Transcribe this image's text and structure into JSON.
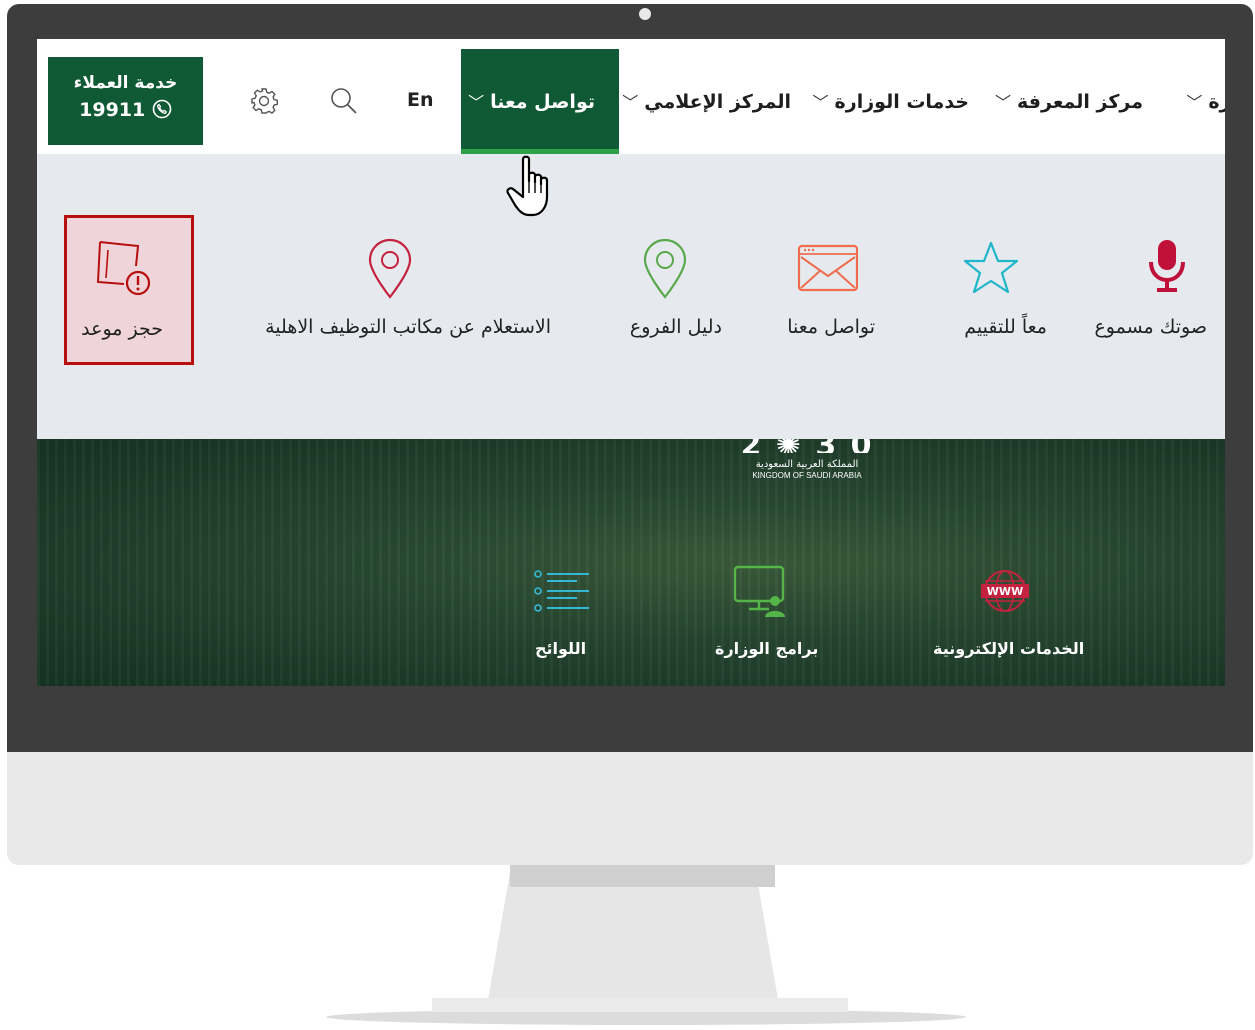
{
  "customer_service": {
    "title": "خدمة العملاء",
    "phone": "19911"
  },
  "toolbar": {
    "language_label": "En",
    "settings_icon": "gear-icon",
    "search_icon": "search-icon"
  },
  "nav": {
    "active": "تواصل معنا",
    "items": [
      "المركز الإعلامي",
      "خدمات الوزارة",
      "مركز المعرفة",
      "ارة"
    ]
  },
  "mega_menu": {
    "items": [
      {
        "label": "صوتك مسموع",
        "icon": "microphone-icon",
        "color": "#c0113a"
      },
      {
        "label": "معاً للتقييم",
        "icon": "star-icon",
        "color": "#1fb6c9"
      },
      {
        "label": "تواصل معنا",
        "icon": "envelope-icon",
        "color": "#ef6d4e"
      },
      {
        "label": "دليل الفروع",
        "icon": "map-pin-icon",
        "color": "#5aa84c"
      },
      {
        "label": "الاستعلام عن مكاتب التوظيف الاهلية",
        "icon": "map-pin-icon",
        "color": "#c4223e"
      },
      {
        "label": "حجز موعد",
        "icon": "appointment-alert-icon",
        "color": "#b70e0e"
      }
    ]
  },
  "hero": {
    "vision_arabic": "المملكة العربية السعودية",
    "vision_english": "KINGDOM OF SAUDI ARABIA",
    "items": [
      {
        "label": "الخدمات الإلكترونية",
        "icon": "www-globe-icon"
      },
      {
        "label": "برامج الوزارة",
        "icon": "computer-user-icon"
      },
      {
        "label": "اللوائح",
        "icon": "list-icon"
      }
    ]
  },
  "colors": {
    "brand_green": "#0f5a35",
    "active_underline": "#2ea04a",
    "highlight_border": "#b70e0e"
  }
}
